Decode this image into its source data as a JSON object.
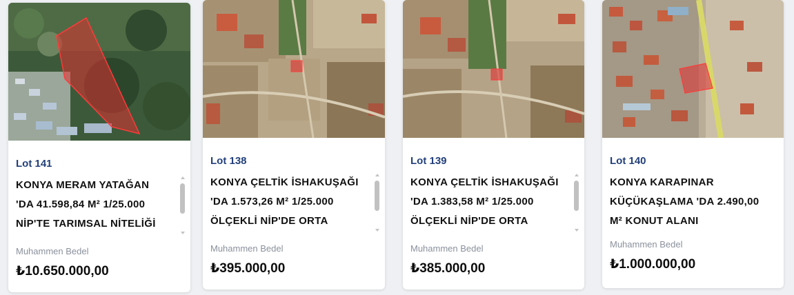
{
  "cards": [
    {
      "lot": "Lot 141",
      "title": "KONYA MERAM YATAĞAN 'DA 41.598,84 M² 1/25.000 NİP'TE TARIMSAL NİTELİĞİ",
      "price_label": "Muhammen Bedel",
      "price": "₺10.650.000,00",
      "image": "satellite-map-forest-parcel"
    },
    {
      "lot": "Lot 138",
      "title": "KONYA ÇELTİK İSHAKUŞAĞI 'DA 1.573,26 M² 1/25.000 ÖLÇEKLİ NİP'DE ORTA",
      "price_label": "Muhammen Bedel",
      "price": "₺395.000,00",
      "image": "satellite-map-village-parcel"
    },
    {
      "lot": "Lot 139",
      "title": "KONYA ÇELTİK İSHAKUŞAĞI 'DA 1.383,58 M² 1/25.000 ÖLÇEKLİ NİP'DE ORTA",
      "price_label": "Muhammen Bedel",
      "price": "₺385.000,00",
      "image": "satellite-map-village-parcel"
    },
    {
      "lot": "Lot 140",
      "title": "KONYA KARAPINAR KÜÇÜKAŞLAMA 'DA 2.490,00 M² KONUT ALANI",
      "price_label": "Muhammen Bedel",
      "price": "₺1.000.000,00",
      "image": "satellite-map-town-parcel"
    }
  ]
}
